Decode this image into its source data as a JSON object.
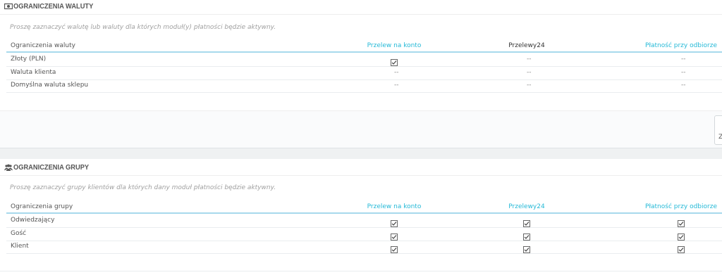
{
  "currency_section": {
    "title": "Ograniczenia waluty",
    "icon": "money-icon",
    "help": "Proszę zaznaczyć walutę lub waluty dla których moduł(y) płatności będzie aktywny.",
    "columns": [
      "Ograniczenia waluty",
      "Przelew na konto",
      "Przelewy24",
      "Płatność przy odbiorze"
    ],
    "rows": [
      {
        "label": "Złoty (PLN)",
        "values": [
          "checked",
          "--",
          "--"
        ]
      },
      {
        "label": "Waluta klienta",
        "values": [
          "--",
          "--",
          "--"
        ]
      },
      {
        "label": "Domyślna waluta sklepu",
        "values": [
          "--",
          "--",
          "--"
        ]
      }
    ],
    "save_label": "Z"
  },
  "group_section": {
    "title": "Ograniczenia grupy",
    "icon": "group-icon",
    "help": "Proszę zaznaczyć grupy klientów dla których dany moduł płatności będzie aktywny.",
    "columns": [
      "Ograniczenia grupy",
      "Przelew na konto",
      "Przelewy24",
      "Płatność przy odbiorze"
    ],
    "rows": [
      {
        "label": "Odwiedzający",
        "values": [
          "checked",
          "checked",
          "checked"
        ]
      },
      {
        "label": "Gość",
        "values": [
          "checked",
          "checked",
          "checked"
        ]
      },
      {
        "label": "Klient",
        "values": [
          "checked",
          "checked",
          "checked"
        ]
      }
    ]
  },
  "colors": {
    "link": "#25b9d7",
    "header_border": "#a7d9ec"
  }
}
